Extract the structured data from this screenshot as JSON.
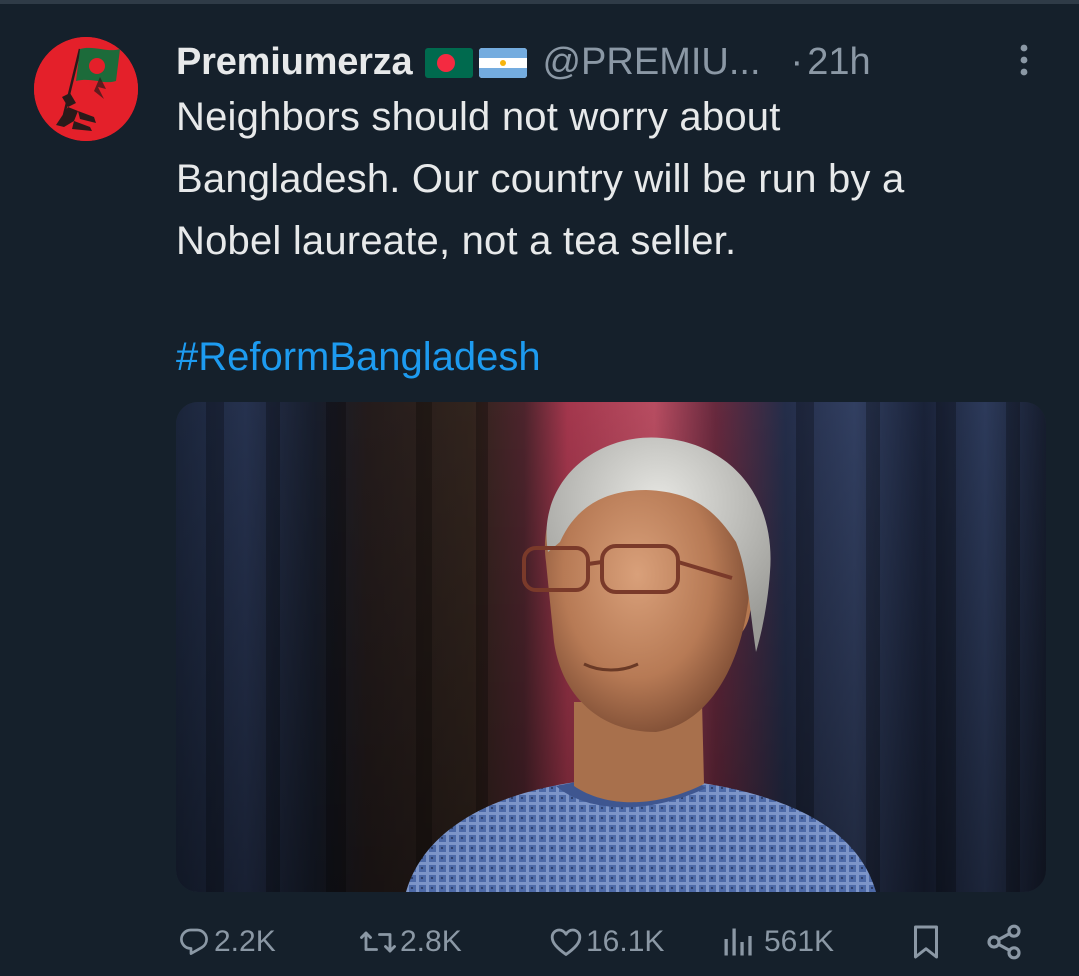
{
  "tweet": {
    "display_name": "Premiumerza",
    "flags": [
      "bangladesh-flag",
      "argentina-flag"
    ],
    "handle": "@PREMIU...",
    "separator": "·",
    "time": "21h",
    "text_lines": [
      "Neighbors should not worry about",
      "Bangladesh. Our country will be run by a",
      "Nobel laureate, not a tea seller."
    ],
    "hashtag": "#ReformBangladesh",
    "media": {
      "type": "photo",
      "subject": "elderly man with glasses in checked blue shirt"
    },
    "actions": {
      "reply_count": "2.2K",
      "retweet_count": "2.8K",
      "like_count": "16.1K",
      "view_count": "561K"
    }
  },
  "icons": {
    "reply": "reply-icon",
    "retweet": "retweet-icon",
    "like": "heart-icon",
    "views": "views-icon",
    "bookmark": "bookmark-icon",
    "share": "share-icon",
    "more": "more-vertical-icon"
  },
  "colors": {
    "background": "#15202b",
    "text": "#e7e9ea",
    "muted": "#8b98a5",
    "link": "#1d9bf0",
    "avatar": "#e4202a"
  }
}
